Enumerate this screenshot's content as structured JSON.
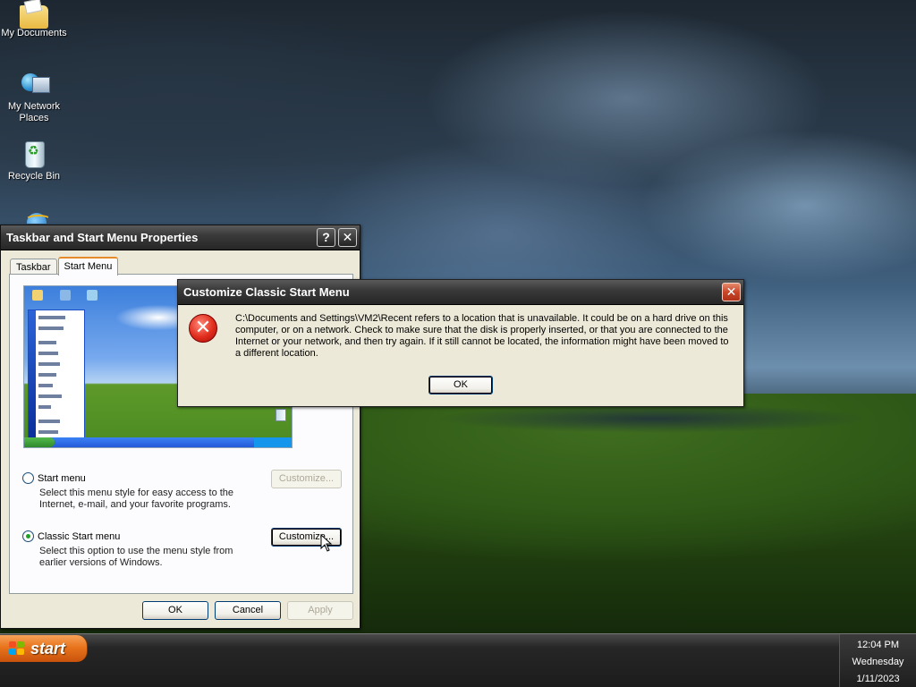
{
  "desktop": {
    "icons": [
      {
        "label": "My Documents"
      },
      {
        "label": "My Network Places"
      },
      {
        "label": "Recycle Bin"
      }
    ]
  },
  "properties_dialog": {
    "title": "Taskbar and Start Menu Properties",
    "help_button": "?",
    "close_button": "✕",
    "tabs": [
      {
        "label": "Taskbar",
        "active": false
      },
      {
        "label": "Start Menu",
        "active": true
      }
    ],
    "option_start_menu": {
      "label": "Start menu",
      "description": "Select this menu style for easy access to the Internet, e-mail, and your favorite programs.",
      "customize_label": "Customize...",
      "checked": false
    },
    "option_classic": {
      "label": "Classic Start menu",
      "description": "Select this option to use the menu style from earlier versions of Windows.",
      "customize_label": "Customize...",
      "checked": true
    },
    "ok_label": "OK",
    "cancel_label": "Cancel",
    "apply_label": "Apply"
  },
  "error_dialog": {
    "title": "Customize Classic Start Menu",
    "close_button": "✕",
    "icon": "error-icon",
    "icon_glyph": "✕",
    "message": "C:\\Documents and Settings\\VM2\\Recent refers to a location that is unavailable. It could be on a hard drive on this computer, or on a network. Check to make sure that the disk is properly inserted, or that you are connected to the Internet or your network, and then try again. If it still cannot be located, the information might have been moved to a different location.",
    "ok_label": "OK"
  },
  "taskbar": {
    "start_label": "start",
    "clock": {
      "time": "12:04 PM",
      "day": "Wednesday",
      "date": "1/11/2023"
    }
  },
  "colors": {
    "start_button": "#e8741d",
    "titlebar": "#2e2e2e",
    "error_red": "#e02c1c",
    "dialog_face": "#ece9d8"
  }
}
